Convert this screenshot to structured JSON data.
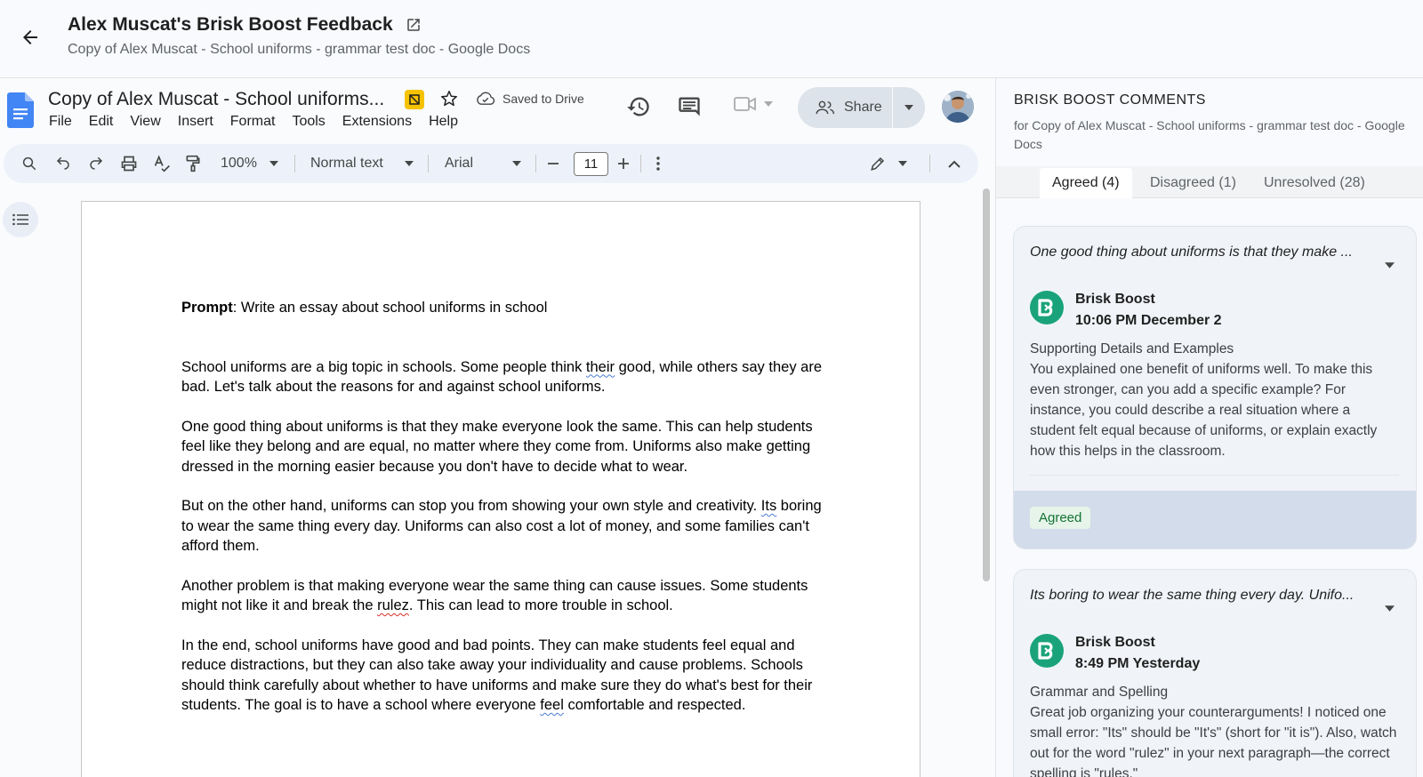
{
  "header": {
    "title": "Alex Muscat's Brisk Boost Feedback",
    "subtitle": "Copy of Alex Muscat - School uniforms - grammar test doc - Google Docs"
  },
  "docs": {
    "doc_title": "Copy of Alex Muscat - School uniforms...",
    "saved_status": "Saved to Drive",
    "menu": [
      "File",
      "Edit",
      "View",
      "Insert",
      "Format",
      "Tools",
      "Extensions",
      "Help"
    ],
    "share_label": "Share",
    "toolbar": {
      "zoom": "100%",
      "style": "Normal text",
      "font": "Arial",
      "font_size": "11"
    },
    "content": {
      "prompt_label": "Prompt",
      "prompt_text": ": Write an essay about school uniforms in school",
      "p1_a": "School uniforms are a big topic in schools. Some people think ",
      "p1_err": "their",
      "p1_b": " good, while others say they are bad. Let's talk about the reasons for and against school uniforms.",
      "p2": "One good thing about uniforms is that they make everyone look the same. This can help students feel like they belong and are equal, no matter where they come from. Uniforms also make getting dressed in the morning easier because you don't have to decide what to wear.",
      "p3_a": "But on the other hand, uniforms can stop you from showing your own style and creativity. ",
      "p3_err": "Its",
      "p3_b": " boring to wear the same thing every day. Uniforms can also cost a lot of money, and some families can't afford them.",
      "p4_a": "Another problem is that making everyone wear the same thing can cause issues. Some students might not like it and break the ",
      "p4_err": "rulez",
      "p4_b": ". This can lead to more trouble in school.",
      "p5_a": "In the end, school uniforms have good and bad points. They can make students feel equal and reduce distractions, but they can also take away your individuality and cause problems. Schools should think carefully about whether to have uniforms and make sure they do what's best for their students. The goal is to have a school where everyone ",
      "p5_err": "feel",
      "p5_b": " comfortable and respected."
    }
  },
  "panel": {
    "title": "BRISK BOOST COMMENTS",
    "subtitle": "for Copy of Alex Muscat - School uniforms - grammar test doc - Google Docs",
    "tabs": [
      {
        "label": "Agreed (4)"
      },
      {
        "label": "Disagreed (1)"
      },
      {
        "label": "Unresolved (28)"
      }
    ],
    "comments": [
      {
        "quote": "One good thing about uniforms is that they make ...",
        "author": "Brisk Boost",
        "time": "10:06 PM December 2",
        "category": "Supporting Details and Examples",
        "text": "You explained one benefit of uniforms well. To make this even stronger, can you add a specific example? For instance, you could describe a real situation where a student felt equal because of uniforms, or explain exactly how this helps in the classroom.",
        "status": "Agreed"
      },
      {
        "quote": "Its boring to wear the same thing every day. Unifo...",
        "author": "Brisk Boost",
        "time": "8:49 PM Yesterday",
        "category": "Grammar and Spelling",
        "text": "Great job organizing your counterarguments! I noticed one small error: \"Its\" should be \"It's\" (short for \"it is\"). Also, watch out for the word \"rulez\" in your next paragraph—the correct spelling is \"rules.\""
      }
    ]
  }
}
